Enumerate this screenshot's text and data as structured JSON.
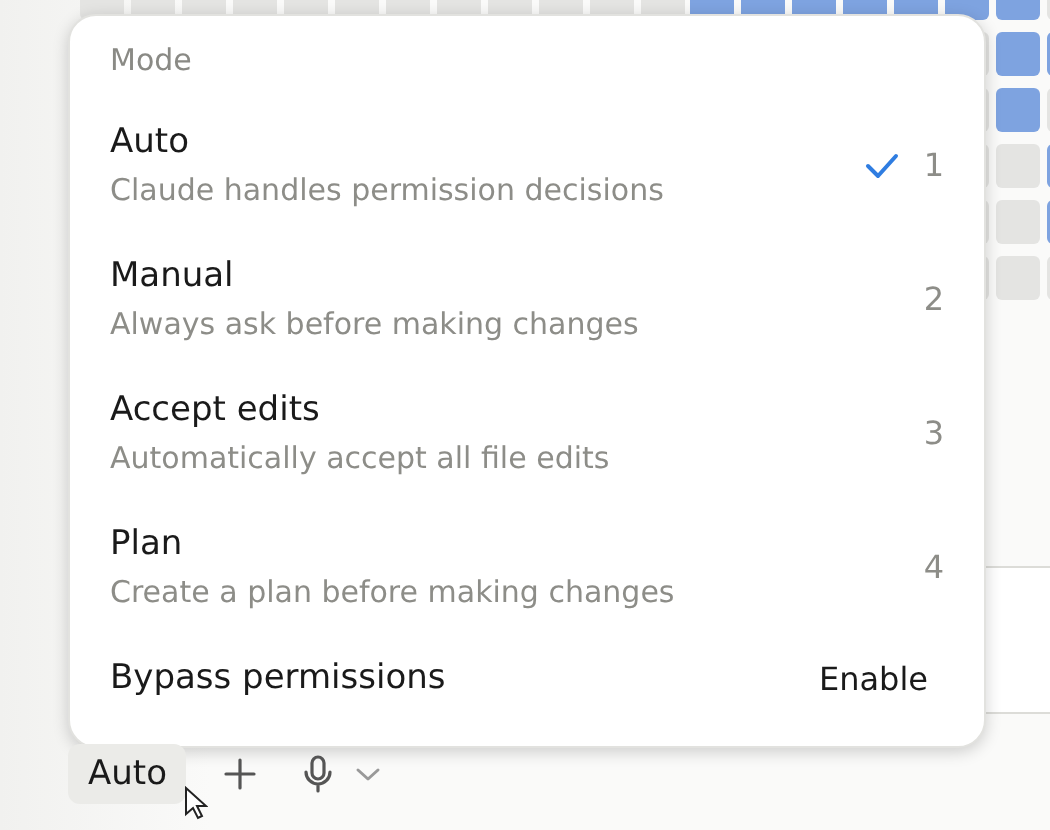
{
  "menu": {
    "heading": "Mode",
    "options": [
      {
        "label": "Auto",
        "description": "Claude handles permission decisions",
        "shortcut": "1",
        "selected": true
      },
      {
        "label": "Manual",
        "description": "Always ask before making changes",
        "shortcut": "2",
        "selected": false
      },
      {
        "label": "Accept edits",
        "description": "Automatically accept all file edits",
        "shortcut": "3",
        "selected": false
      },
      {
        "label": "Plan",
        "description": "Create a plan before making changes",
        "shortcut": "4",
        "selected": false
      }
    ],
    "bypass": {
      "label": "Bypass permissions",
      "action": "Enable"
    }
  },
  "toolbar": {
    "mode_button": "Auto"
  }
}
